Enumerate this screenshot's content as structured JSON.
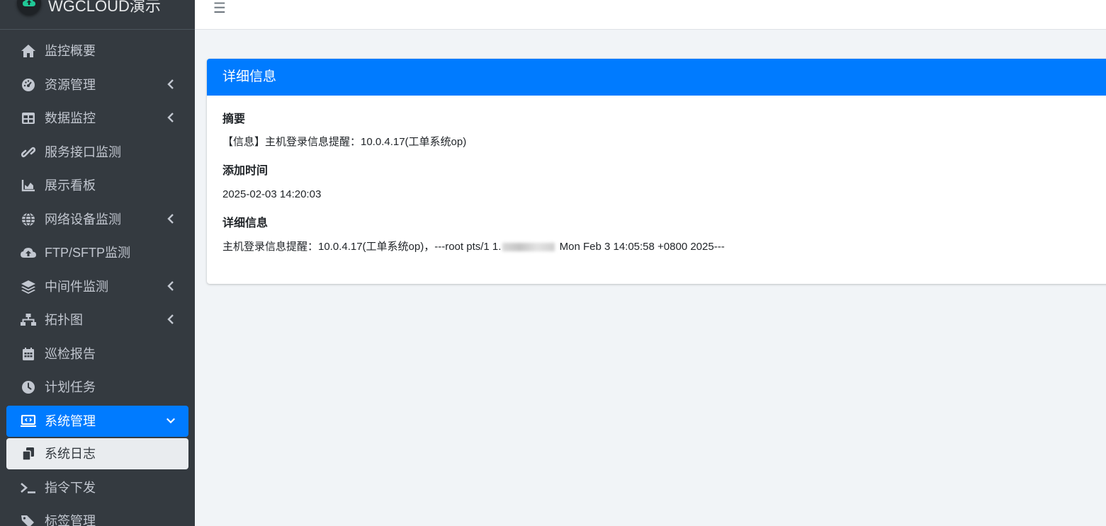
{
  "brand": {
    "title": "WGCLOUD演示",
    "logo_icon": "cloud-upload-icon"
  },
  "sidebar": {
    "items": [
      {
        "label": "监控概要",
        "icon": "home-icon",
        "has_children": false
      },
      {
        "label": "资源管理",
        "icon": "tachometer-icon",
        "has_children": true
      },
      {
        "label": "数据监控",
        "icon": "table-icon",
        "has_children": true
      },
      {
        "label": "服务接口监测",
        "icon": "link-icon",
        "has_children": false
      },
      {
        "label": "展示看板",
        "icon": "chart-area-icon",
        "has_children": false
      },
      {
        "label": "网络设备监测",
        "icon": "globe-icon",
        "has_children": true
      },
      {
        "label": "FTP/SFTP监测",
        "icon": "cloud-upload-icon",
        "has_children": false
      },
      {
        "label": "中间件监测",
        "icon": "layers-icon",
        "has_children": true
      },
      {
        "label": "拓扑图",
        "icon": "sitemap-icon",
        "has_children": true
      },
      {
        "label": "巡检报告",
        "icon": "calendar-icon",
        "has_children": false
      },
      {
        "label": "计划任务",
        "icon": "clock-icon",
        "has_children": false
      },
      {
        "label": "系统管理",
        "icon": "laptop-code-icon",
        "has_children": true,
        "expanded": true,
        "active": true
      },
      {
        "label": "系统日志",
        "icon": "copy-icon",
        "sub": true,
        "active": true
      },
      {
        "label": "指令下发",
        "icon": "terminal-icon",
        "has_children": false
      },
      {
        "label": "标签管理",
        "icon": "tags-icon",
        "has_children": false
      }
    ]
  },
  "topbar": {
    "menu_icon": "hamburger-icon",
    "menu_glyph": "☰"
  },
  "card": {
    "title": "详细信息",
    "summary_label": "摘要",
    "summary_value": "【信息】主机登录信息提醒：10.0.4.17(工单系统op)",
    "time_label": "添加时间",
    "time_value": "2025-02-03 14:20:03",
    "detail_label": "详细信息",
    "detail_value_prefix": "主机登录信息提醒：10.0.4.17(工单系统op)，---root pts/1 1.",
    "detail_value_suffix": " Mon Feb 3 14:05:58 +0800 2025---"
  },
  "colors": {
    "sidebar_bg": "#343a40",
    "accent": "#007bff",
    "page_bg": "#f1f4f7",
    "brand_green": "#20c997"
  }
}
